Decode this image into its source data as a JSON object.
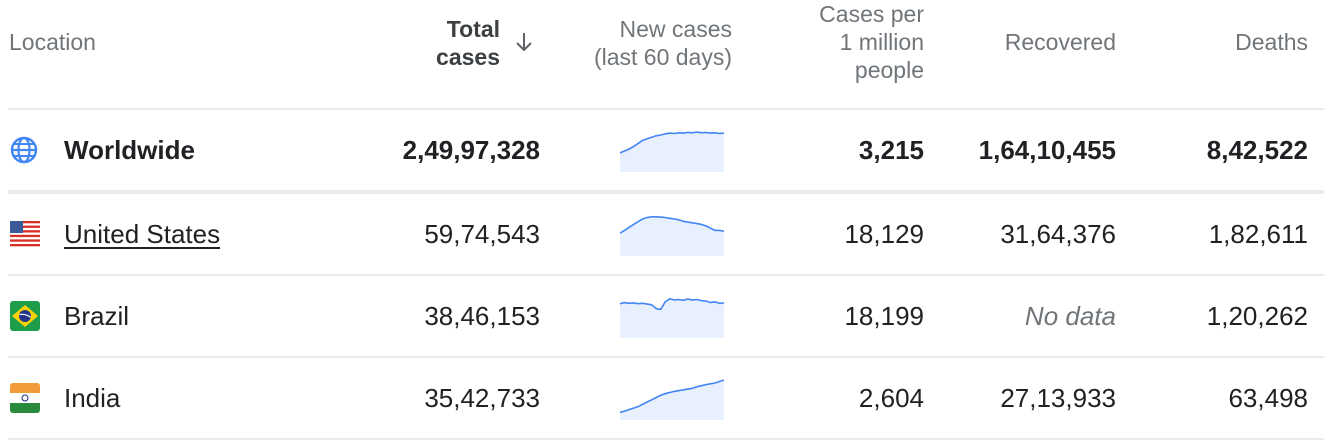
{
  "header": {
    "location": "Location",
    "total_cases_line1": "Total",
    "total_cases_line2": "cases",
    "new_cases_line1": "New cases",
    "new_cases_line2": "(last 60 days)",
    "per_million_line1": "Cases per",
    "per_million_line2": "1 million",
    "per_million_line3": "people",
    "recovered": "Recovered",
    "deaths": "Deaths",
    "sort_icon": "arrow-down-icon"
  },
  "rows": [
    {
      "name": "Worldwide",
      "icon": "globe-icon",
      "total_cases": "2,49,97,328",
      "per_million": "3,215",
      "recovered": "1,64,10,455",
      "deaths": "8,42,522",
      "trend": [
        0.45,
        0.5,
        0.55,
        0.62,
        0.7,
        0.78,
        0.82,
        0.86,
        0.9,
        0.92,
        0.95,
        0.97,
        0.96,
        0.98,
        0.97,
        0.99,
        0.98,
        1.0,
        0.98,
        0.99,
        0.97,
        0.98,
        0.96,
        0.97
      ]
    },
    {
      "name": "United States",
      "icon": "us-flag-icon",
      "total_cases": "59,74,543",
      "per_million": "18,129",
      "recovered": "31,64,376",
      "deaths": "1,82,611",
      "trend": [
        0.55,
        0.62,
        0.7,
        0.78,
        0.85,
        0.92,
        0.96,
        0.98,
        0.98,
        0.97,
        0.96,
        0.94,
        0.92,
        0.9,
        0.86,
        0.84,
        0.82,
        0.8,
        0.78,
        0.74,
        0.68,
        0.62,
        0.62,
        0.6
      ]
    },
    {
      "name": "Brazil",
      "icon": "brazil-flag-icon",
      "total_cases": "38,46,153",
      "per_million": "18,199",
      "recovered": "No data",
      "deaths": "1,20,262",
      "trend": [
        0.85,
        0.88,
        0.86,
        0.87,
        0.85,
        0.86,
        0.84,
        0.82,
        0.72,
        0.7,
        0.9,
        0.98,
        0.95,
        0.96,
        0.94,
        0.97,
        0.95,
        0.96,
        0.93,
        0.92,
        0.88,
        0.9,
        0.86,
        0.87
      ]
    },
    {
      "name": "India",
      "icon": "india-flag-icon",
      "total_cases": "35,42,733",
      "per_million": "2,604",
      "recovered": "27,13,933",
      "deaths": "63,498",
      "trend": [
        0.15,
        0.18,
        0.22,
        0.26,
        0.3,
        0.36,
        0.42,
        0.48,
        0.54,
        0.6,
        0.64,
        0.67,
        0.7,
        0.72,
        0.74,
        0.76,
        0.78,
        0.82,
        0.85,
        0.88,
        0.9,
        0.92,
        0.96,
        1.0
      ]
    }
  ],
  "colors": {
    "spark_line": "#4285f4",
    "spark_fill": "#e8f0fe",
    "divider": "#e8eaed"
  }
}
